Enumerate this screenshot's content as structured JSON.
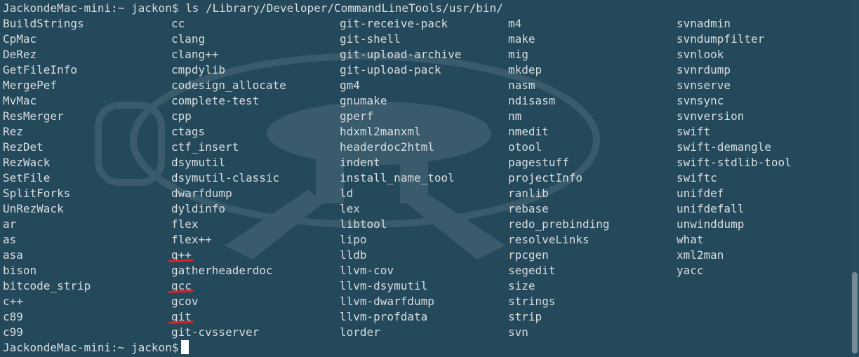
{
  "terminal": {
    "command_prompt": "JackondeMac-mini:~ jackon$ ls /Library/Developer/CommandLineTools/usr/bin/",
    "final_prompt": "JackondeMac-mini:~ jackon$",
    "columns": [
      [
        "BuildStrings",
        "CpMac",
        "DeRez",
        "GetFileInfo",
        "MergePef",
        "MvMac",
        "ResMerger",
        "Rez",
        "RezDet",
        "RezWack",
        "SetFile",
        "SplitForks",
        "UnRezWack",
        "ar",
        "as",
        "asa",
        "bison",
        "bitcode_strip",
        "c++",
        "c89",
        "c99"
      ],
      [
        "cc",
        "clang",
        "clang++",
        "cmpdylib",
        "codesign_allocate",
        "complete-test",
        "cpp",
        "ctags",
        "ctf_insert",
        "dsymutil",
        "dsymutil-classic",
        "dwarfdump",
        "dyldinfo",
        "flex",
        "flex++",
        "g++",
        "gatherheaderdoc",
        "gcc",
        "gcov",
        "git",
        "git-cvsserver"
      ],
      [
        "git-receive-pack",
        "git-shell",
        "git-upload-archive",
        "git-upload-pack",
        "gm4",
        "gnumake",
        "gperf",
        "hdxml2manxml",
        "headerdoc2html",
        "indent",
        "install_name_tool",
        "ld",
        "lex",
        "libtool",
        "lipo",
        "lldb",
        "llvm-cov",
        "llvm-dsymutil",
        "llvm-dwarfdump",
        "llvm-profdata",
        "lorder"
      ],
      [
        "m4",
        "make",
        "mig",
        "mkdep",
        "nasm",
        "ndisasm",
        "nm",
        "nmedit",
        "otool",
        "pagestuff",
        "projectInfo",
        "ranlib",
        "rebase",
        "redo_prebinding",
        "resolveLinks",
        "rpcgen",
        "segedit",
        "size",
        "strings",
        "strip",
        "svn"
      ],
      [
        "svnadmin",
        "svndumpfilter",
        "svnlook",
        "svnrdump",
        "svnserve",
        "svnsync",
        "svnversion",
        "swift",
        "swift-demangle",
        "swift-stdlib-tool",
        "swiftc",
        "unifdef",
        "unifdefall",
        "unwinddump",
        "what",
        "xml2man",
        "yacc"
      ]
    ],
    "highlighted_items": [
      "g++",
      "gcc",
      "git"
    ],
    "colors": {
      "background": "#24495a",
      "text": "#d8dde2",
      "cursor": "#ffffff",
      "annotation": "#e22222"
    }
  }
}
